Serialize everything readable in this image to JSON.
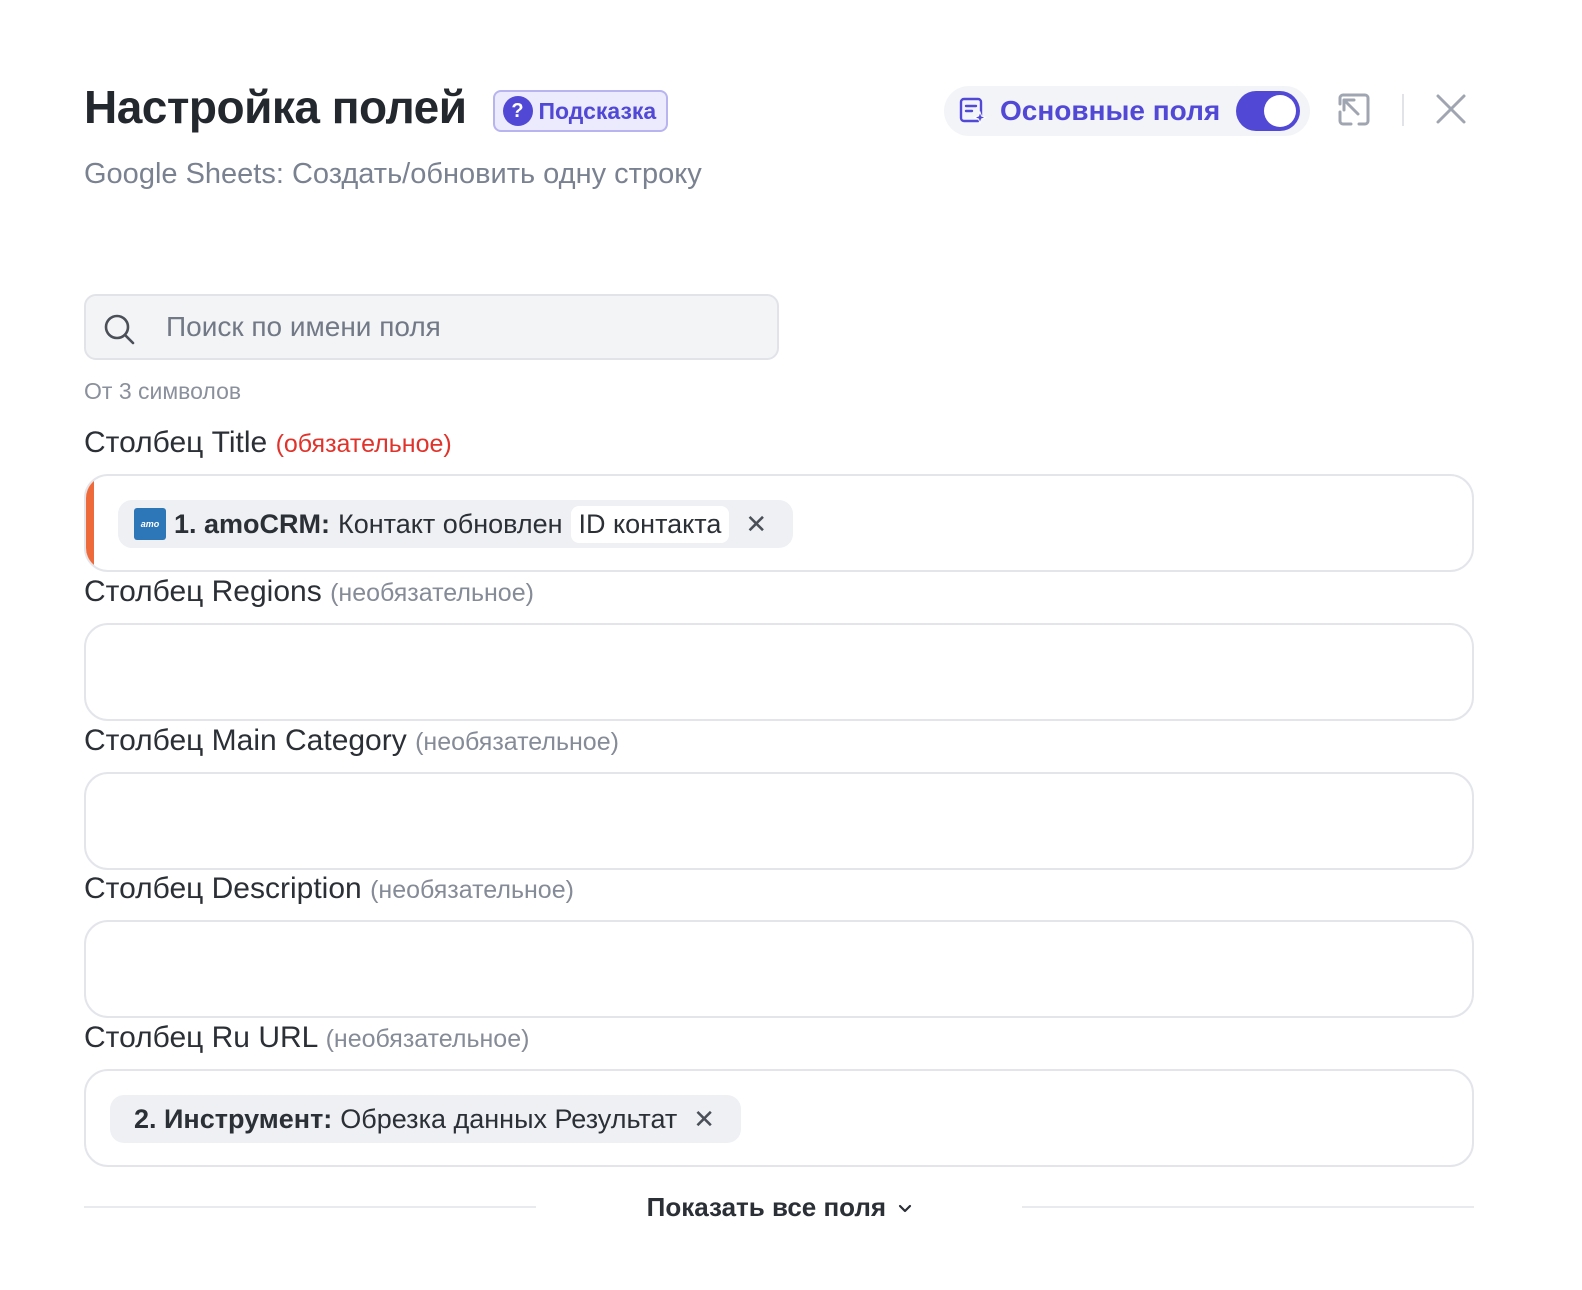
{
  "header": {
    "title": "Настройка полей",
    "hint_label": "Подсказка",
    "subtitle": "Google Sheets: Создать/обновить одну строку",
    "main_fields_label": "Основные поля",
    "main_fields_toggle_on": true
  },
  "search": {
    "placeholder": "Поиск по имени поля",
    "hint": "От 3 символов"
  },
  "fields": [
    {
      "label": "Столбец Title",
      "tag": "(обязательное)",
      "required": true,
      "chip": {
        "app_icon_text": "amo",
        "source": "1. amoCRM:",
        "event": "Контакт обновлен",
        "value": "ID контакта"
      }
    },
    {
      "label": "Столбец Regions",
      "tag": "(необязательное)",
      "required": false
    },
    {
      "label": "Столбец Main Category",
      "tag": "(необязательное)",
      "required": false
    },
    {
      "label": "Столбец Description",
      "tag": "(необязательное)",
      "required": false
    },
    {
      "label": "Столбец Ru URL",
      "tag": "(необязательное)",
      "required": false,
      "chip": {
        "source": "2. Инструмент:",
        "event": "Обрезка данных Результат"
      }
    }
  ],
  "footer": {
    "show_all_label": "Показать все поля"
  },
  "colors": {
    "accent": "#5149d6",
    "required": "#e0332b",
    "required_bar": "#ef6a3a",
    "amocrm_icon": "#2d77b8"
  },
  "icons": {
    "hint": "question-circle-icon",
    "main_fields": "list-sparkle-icon",
    "collapse": "arrow-up-left-square-icon",
    "close": "close-icon",
    "search": "search-icon",
    "chip_remove": "close-icon",
    "show_all": "chevron-down-icon"
  }
}
